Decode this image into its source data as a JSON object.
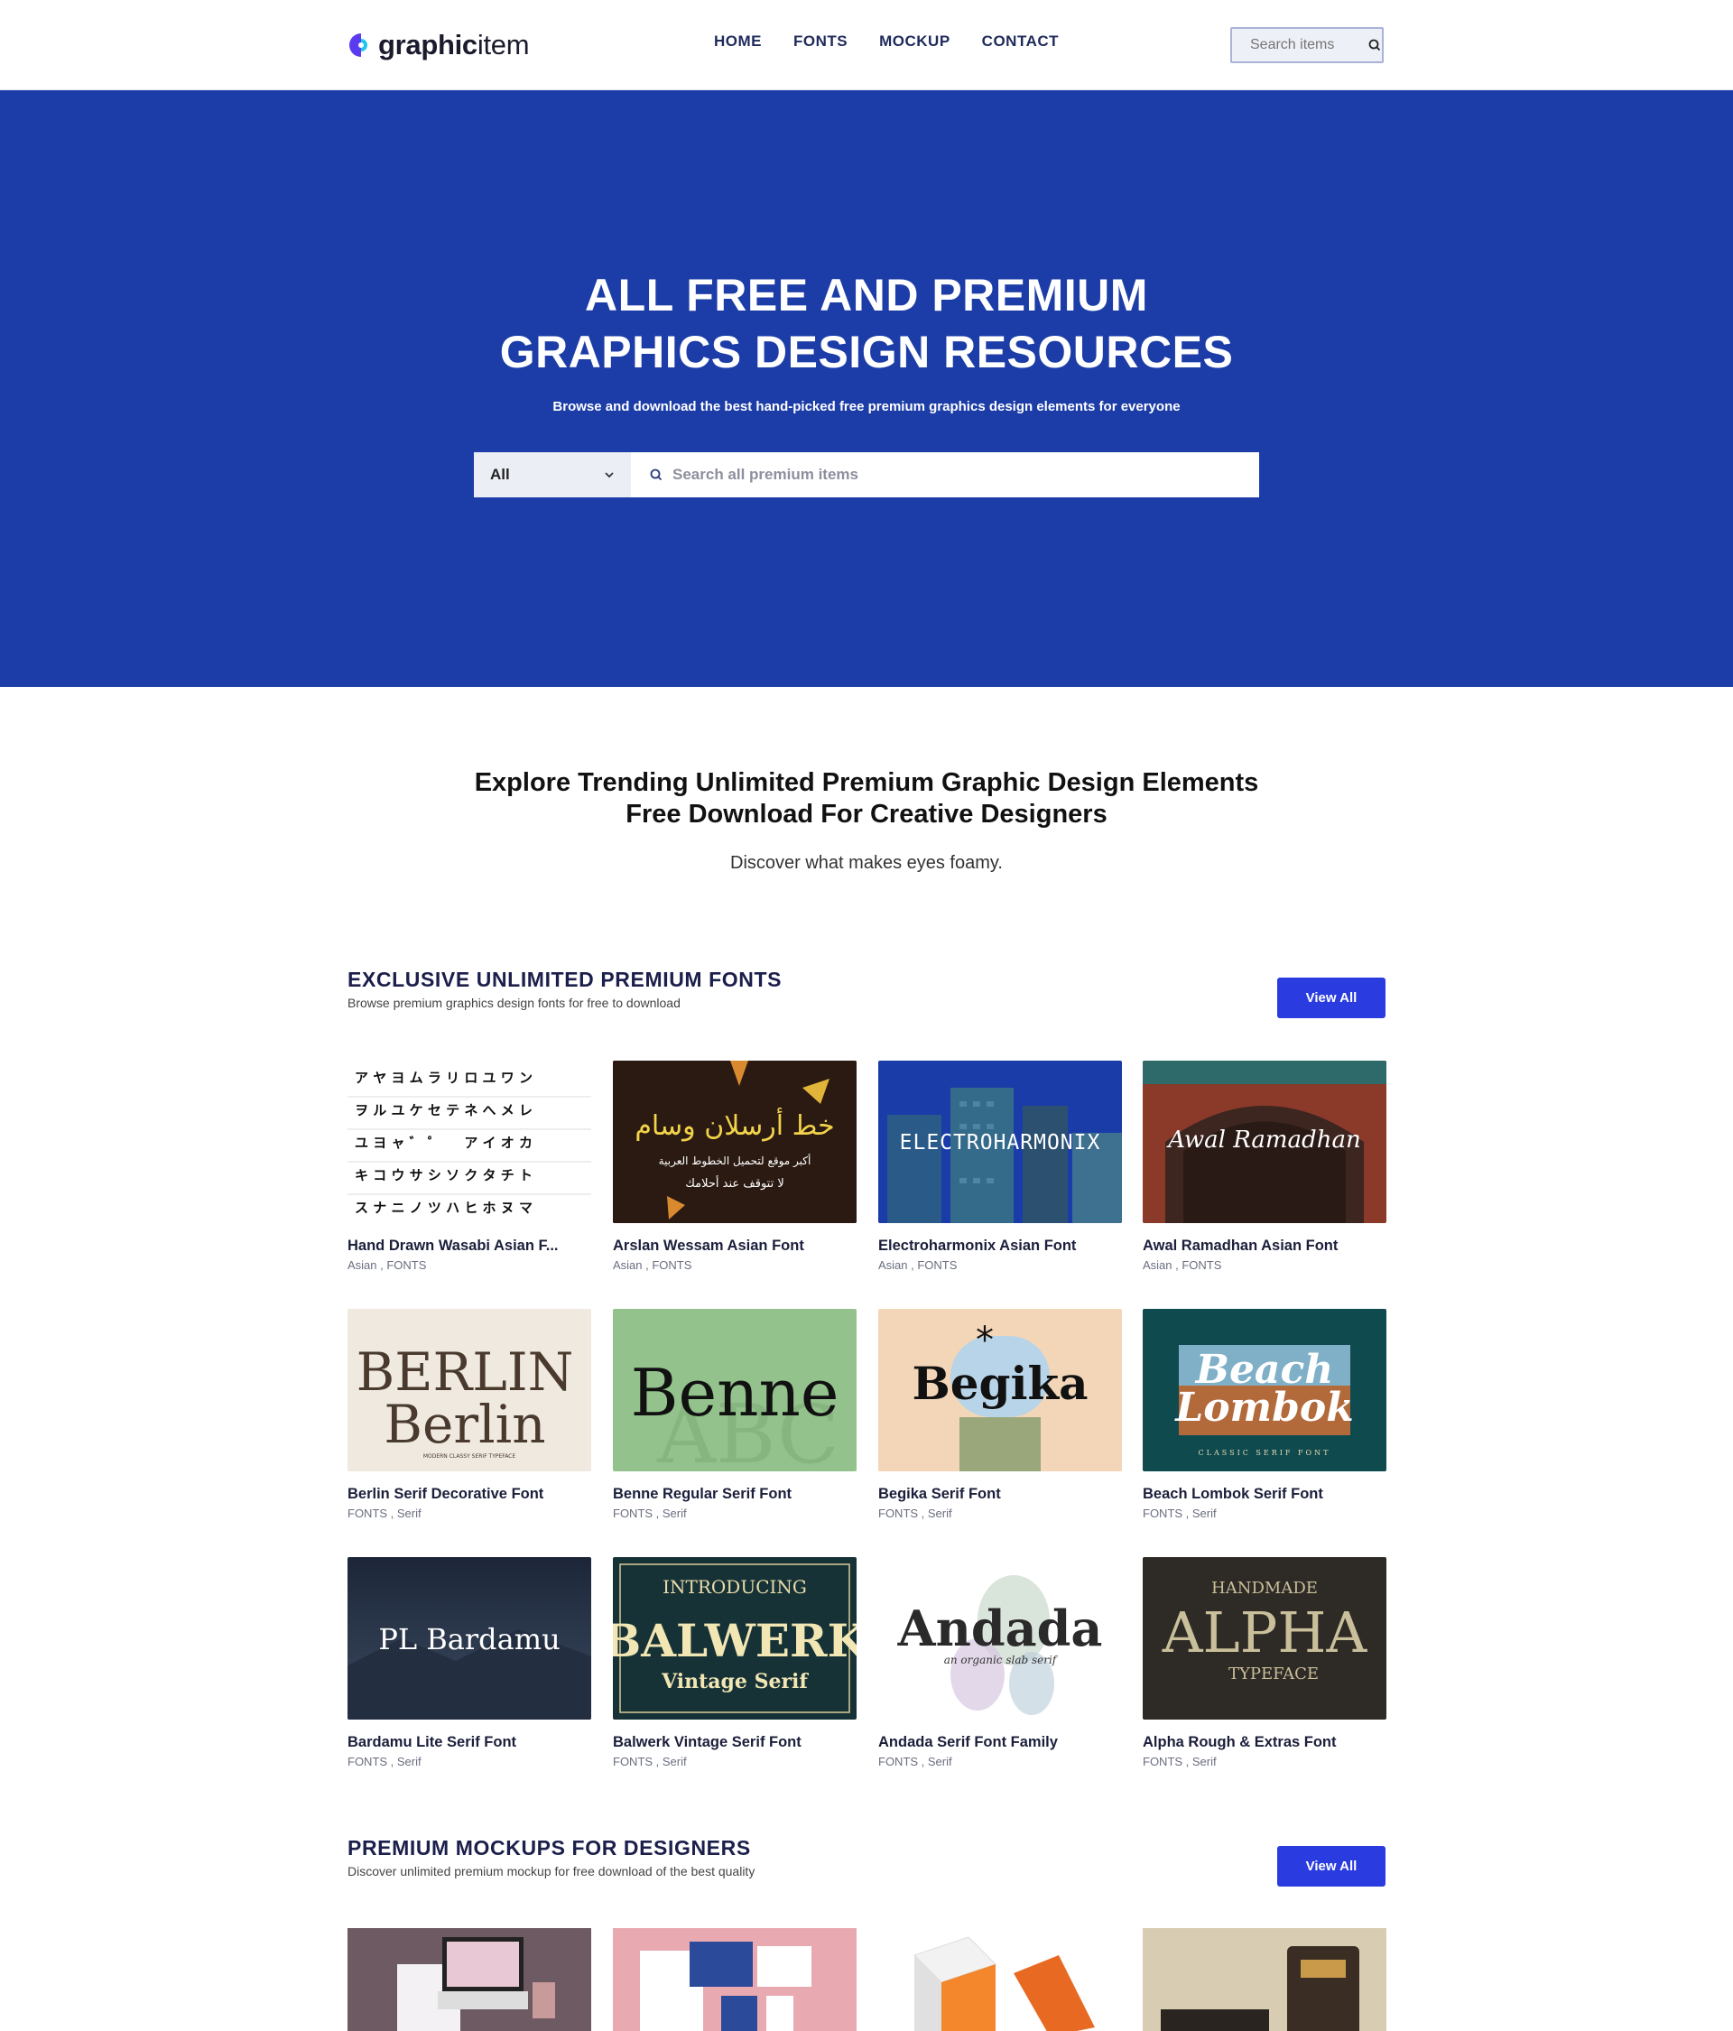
{
  "header": {
    "logo_bold": "graphic",
    "logo_light": "item",
    "nav": [
      "HOME",
      "FONTS",
      "MOCKUP",
      "CONTACT"
    ],
    "search_placeholder": "Search items"
  },
  "hero": {
    "title_line1": "ALL FREE AND PREMIUM",
    "title_line2": "GRAPHICS DESIGN RESOURCES",
    "subtitle": "Browse and download the best hand-picked free premium graphics design elements for everyone",
    "select_value": "All",
    "search_placeholder": "Search all premium items"
  },
  "intro": {
    "title_line1": "Explore Trending Unlimited Premium Graphic Design Elements",
    "title_line2": "Free Download For Creative Designers",
    "subtitle": "Discover what makes eyes foamy."
  },
  "fonts_section": {
    "title": "EXCLUSIVE UNLIMITED PREMIUM FONTS",
    "subtitle": "Browse premium graphics design fonts for free to download",
    "view_all": "View All",
    "items": [
      {
        "title": "Hand Drawn Wasabi Asian F...",
        "cats": "Asian , FONTS",
        "thumb_text": "ア ヤ ヨ ム ラ リ ロ ユ ワ ン"
      },
      {
        "title": "Arslan Wessam Asian Font",
        "cats": "Asian , FONTS",
        "thumb_text": "خط أرسلان وسام"
      },
      {
        "title": "Electroharmonix Asian Font",
        "cats": "Asian , FONTS",
        "thumb_text": "ELECTROHARMONIX"
      },
      {
        "title": "Awal Ramadhan Asian Font",
        "cats": "Asian , FONTS",
        "thumb_text": "Awal Ramadhan"
      },
      {
        "title": "Berlin Serif Decorative Font",
        "cats": "FONTS , Serif",
        "thumb_text": "BERLIN"
      },
      {
        "title": "Benne Regular Serif Font",
        "cats": "FONTS , Serif",
        "thumb_text": "Benne"
      },
      {
        "title": "Begika Serif Font",
        "cats": "FONTS , Serif",
        "thumb_text": "Begika"
      },
      {
        "title": "Beach Lombok Serif Font",
        "cats": "FONTS , Serif",
        "thumb_text": "Beach"
      },
      {
        "title": "Bardamu Lite Serif Font",
        "cats": "FONTS , Serif",
        "thumb_text": "PL Bardamu"
      },
      {
        "title": "Balwerk Vintage Serif Font",
        "cats": "FONTS , Serif",
        "thumb_text": "BALWERK"
      },
      {
        "title": "Andada Serif Font Family",
        "cats": "FONTS , Serif",
        "thumb_text": "Andada"
      },
      {
        "title": "Alpha Rough & Extras Font",
        "cats": "FONTS , Serif",
        "thumb_text": "ALPHA"
      }
    ]
  },
  "mockups_section": {
    "title": "PREMIUM MOCKUPS FOR DESIGNERS",
    "subtitle": "Discover unlimited premium mockup for free download of the best quality",
    "view_all": "View All"
  },
  "colors": {
    "hero_bg": "#1c3da7",
    "button_bg": "#2a3be0",
    "heading": "#1b1f4b"
  }
}
